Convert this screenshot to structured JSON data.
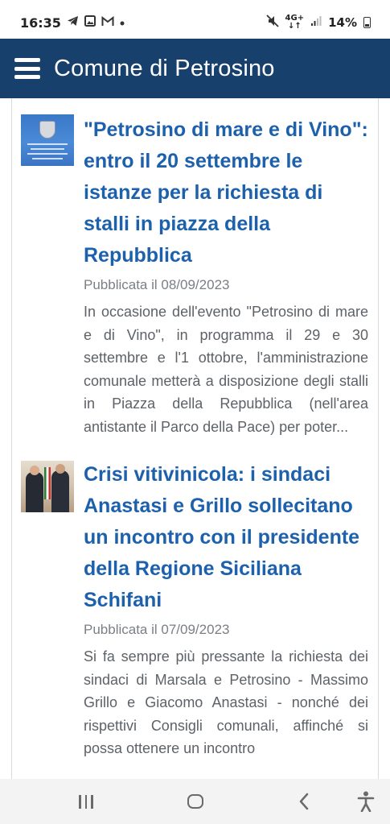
{
  "status_bar": {
    "time": "16:35",
    "left_icons": [
      "telegram-icon",
      "gallery-icon",
      "gmail-icon",
      "dot-icon"
    ],
    "network": "4G+",
    "battery": "14%"
  },
  "app_bar": {
    "title": "Comune di Petrosino",
    "menu_icon": "hamburger-menu-icon",
    "background": "#17416c"
  },
  "articles": [
    {
      "thumbnail": "avviso-pubblico-thumbnail",
      "title": "\"Petrosino di mare e di Vino\": entro il 20 settembre le istanze per la richiesta di stalli in piazza della Repubblica",
      "date": "Pubblicata il 08/09/2023",
      "excerpt": "In occasione dell'evento \"Petrosino di mare e di Vino\", in programma il 29 e 30 settembre e l'1 ottobre, l'amministrazione comunale metterà a disposizione degli stalli in Piazza della Repubblica (nell'area antistante il Parco della Pace) per poter..."
    },
    {
      "thumbnail": "sindaci-photo-thumbnail",
      "title": "Crisi vitivinicola: i sindaci Anastasi e Grillo sollecitano un incontro con il presidente della Regione Siciliana Schifani",
      "date": "Pubblicata il 07/09/2023",
      "excerpt": "Si fa sempre più pressante la richiesta dei sindaci di Marsala e Petrosino - Massimo Grillo e Giacomo Anastasi - nonché dei rispettivi Consigli comunali, affinché si possa ottenere un incontro"
    }
  ],
  "colors": {
    "title": "#1d61ad",
    "date": "#7a7f86",
    "excerpt": "#5d6268"
  },
  "nav_bar": {
    "buttons": [
      "recents-icon",
      "home-icon",
      "back-icon",
      "accessibility-icon"
    ]
  }
}
